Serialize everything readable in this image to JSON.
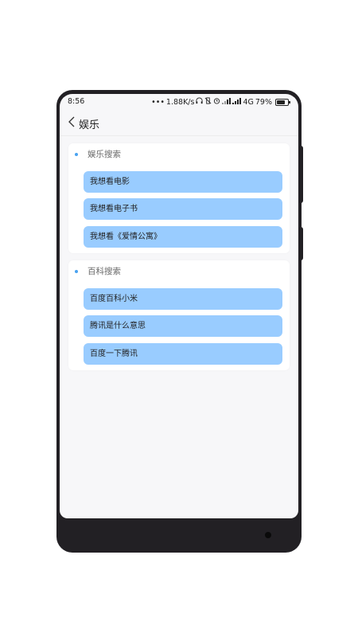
{
  "status_bar": {
    "time": "8:56",
    "dots": "•••",
    "speed": "1.88K/s",
    "icons": [
      "headset-icon",
      "vibrate-off-icon",
      "alarm-icon",
      "signal-icon",
      "signal-icon"
    ],
    "network": "4G",
    "battery": "79%"
  },
  "nav": {
    "title": "娱乐"
  },
  "sections": [
    {
      "title": "娱乐搜索",
      "items": [
        "我想看电影",
        "我想看电子书",
        "我想看《爱情公寓》"
      ]
    },
    {
      "title": "百科搜索",
      "items": [
        "百度百科小米",
        "腾讯是什么意思",
        "百度一下腾讯"
      ]
    }
  ],
  "colors": {
    "accent": "#4aa3f0",
    "item_bg": "#99ccff",
    "screen_bg": "#f7f7f9"
  }
}
